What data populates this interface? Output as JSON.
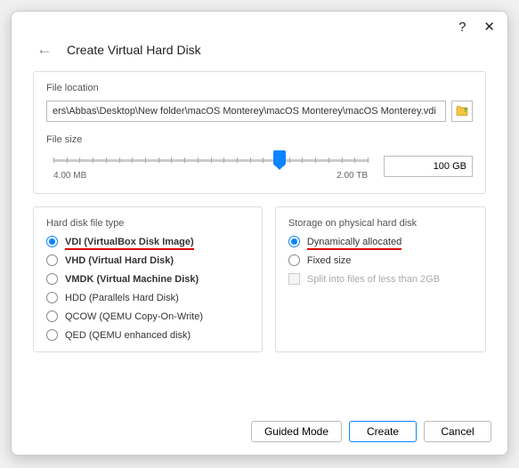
{
  "titlebar": {
    "help": "?",
    "close": "✕"
  },
  "header": {
    "title": "Create Virtual Hard Disk"
  },
  "location": {
    "label": "File location",
    "path": "ers\\Abbas\\Desktop\\New folder\\macOS Monterey\\macOS Monterey\\macOS Monterey.vdi"
  },
  "size": {
    "label": "File size",
    "value": "100 GB",
    "min_label": "4.00 MB",
    "max_label": "2.00 TB",
    "thumb_percent": 72
  },
  "filetype": {
    "label": "Hard disk file type",
    "options": [
      {
        "label": "VDI (VirtualBox Disk Image)",
        "checked": true,
        "bold": true,
        "highlight": true
      },
      {
        "label": "VHD (Virtual Hard Disk)",
        "checked": false,
        "bold": true
      },
      {
        "label": "VMDK (Virtual Machine Disk)",
        "checked": false,
        "bold": true
      },
      {
        "label": "HDD (Parallels Hard Disk)",
        "checked": false
      },
      {
        "label": "QCOW (QEMU Copy-On-Write)",
        "checked": false
      },
      {
        "label": "QED (QEMU enhanced disk)",
        "checked": false
      }
    ]
  },
  "storage": {
    "label": "Storage on physical hard disk",
    "options": [
      {
        "label": "Dynamically allocated",
        "checked": true,
        "highlight": true
      },
      {
        "label": "Fixed size",
        "checked": false
      }
    ],
    "split": {
      "label": "Split into files of less than 2GB",
      "checked": false,
      "disabled": true
    }
  },
  "footer": {
    "guided": "Guided Mode",
    "create": "Create",
    "cancel": "Cancel"
  }
}
